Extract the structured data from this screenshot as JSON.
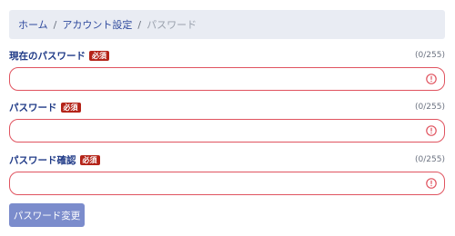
{
  "breadcrumb": {
    "items": [
      "ホーム",
      "アカウント設定"
    ],
    "separator": "/",
    "current": "パスワード"
  },
  "fields": [
    {
      "label": "現在のパスワード",
      "required_badge": "必須",
      "counter": "(0/255)",
      "value": "",
      "error_icon": "exclamation-circle-icon"
    },
    {
      "label": "パスワード",
      "required_badge": "必須",
      "counter": "(0/255)",
      "value": "",
      "error_icon": "exclamation-circle-icon"
    },
    {
      "label": "パスワード確認",
      "required_badge": "必須",
      "counter": "(0/255)",
      "value": "",
      "error_icon": "exclamation-circle-icon"
    }
  ],
  "submit_label": "パスワード変更",
  "colors": {
    "breadcrumb_bg": "#e9ecf3",
    "link": "#2f4a9e",
    "label": "#1f3a87",
    "required_badge_bg": "#b42318",
    "error_border": "#e0535f",
    "button_bg": "#7b8ccc"
  }
}
